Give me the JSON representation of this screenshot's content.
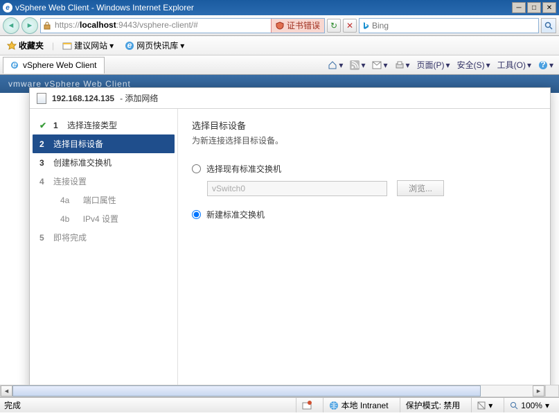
{
  "window": {
    "title": "vSphere Web Client - Windows Internet Explorer"
  },
  "address": {
    "proto": "https://",
    "host": "localhost",
    "port_path": ":9443/vsphere-client/#",
    "cert_error": "证书错误"
  },
  "search": {
    "placeholder": "Bing"
  },
  "favbar": {
    "fav": "收藏夹",
    "sugg": "建议网站",
    "slice": "网页快讯库"
  },
  "tab": {
    "title": "vSphere Web Client"
  },
  "toolbar": {
    "page": "页面(P)",
    "safety": "安全(S)",
    "tools": "工具(O)"
  },
  "vmheader": "vmware vSphere Web Client",
  "wizard": {
    "title_ip": "192.168.124.135",
    "title_suffix": " - 添加网络",
    "steps": {
      "s1": "选择连接类型",
      "s2": "选择目标设备",
      "s3": "创建标准交换机",
      "s4": "连接设置",
      "s4a": "端口属性",
      "s4b": "IPv4 设置",
      "s5": "即将完成",
      "n1": "1",
      "n2": "2",
      "n3": "3",
      "n4": "4",
      "n4a": "4a",
      "n4b": "4b",
      "n5": "5"
    },
    "main": {
      "heading": "选择目标设备",
      "desc": "为新连接选择目标设备。",
      "opt1": "选择现有标准交换机",
      "opt1_val": "vSwitch0",
      "browse": "浏览...",
      "opt2": "新建标准交换机"
    }
  },
  "status": {
    "done": "完成",
    "zone": "本地 Intranet",
    "protect": "保护模式: 禁用",
    "zoom": "100%"
  }
}
